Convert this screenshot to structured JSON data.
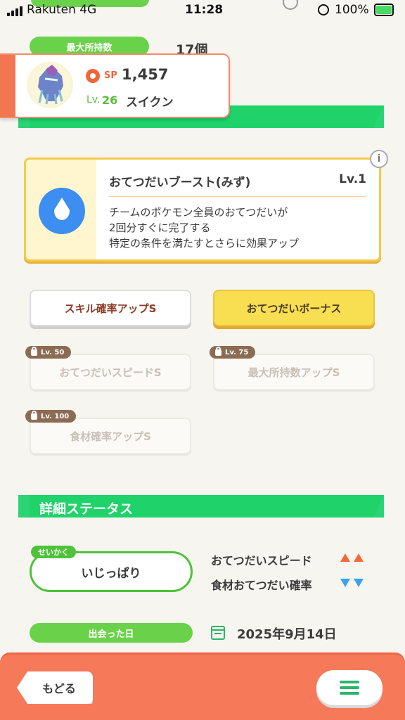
{
  "status_bar": {
    "carrier": "Rakuten  4G",
    "time": "11:28",
    "battery": "100%"
  },
  "max_storage": {
    "label": "最大所持数",
    "value": "17個"
  },
  "pokemon": {
    "sp_label": "SP",
    "sp_value": "1,457",
    "level_prefix": "Lv.",
    "level": "26",
    "name": "スイクン",
    "sprite": "suicune-sprite"
  },
  "main_skill": {
    "name": "おてつだいブースト(みず)",
    "level": "Lv.1",
    "description": [
      "チームのポケモン全員のおてつだいが",
      "2回分すぐに完了する",
      "特定の条件を満たすとさらに効果アップ"
    ],
    "icon": "water-drop-icon",
    "info_icon": "i"
  },
  "sub_skills": [
    {
      "label": "スキル確率アップS",
      "state": "unlocked"
    },
    {
      "label": "おてつだいボーナス",
      "state": "gold"
    },
    {
      "label": "おてつだいスピードS",
      "state": "locked",
      "lock_level": "Lv. 50"
    },
    {
      "label": "最大所持数アップS",
      "state": "locked",
      "lock_level": "Lv. 75"
    },
    {
      "label": "食材確率アップS",
      "state": "locked",
      "lock_level": "Lv. 100"
    }
  ],
  "detail_section": {
    "title": "詳細ステータス"
  },
  "nature": {
    "tag": "せいかく",
    "value": "いじっぱり",
    "effects": [
      {
        "label": "おてつだいスピード",
        "direction": "up",
        "color": "#f36a3a"
      },
      {
        "label": "食材おてつだい確率",
        "direction": "down",
        "color": "#38a2ee"
      }
    ]
  },
  "met_date": {
    "label": "出会った日",
    "value": "2025年9月14日"
  },
  "bottom_bar": {
    "back_label": "もどる",
    "menu_icon": "hamburger-menu-icon"
  }
}
